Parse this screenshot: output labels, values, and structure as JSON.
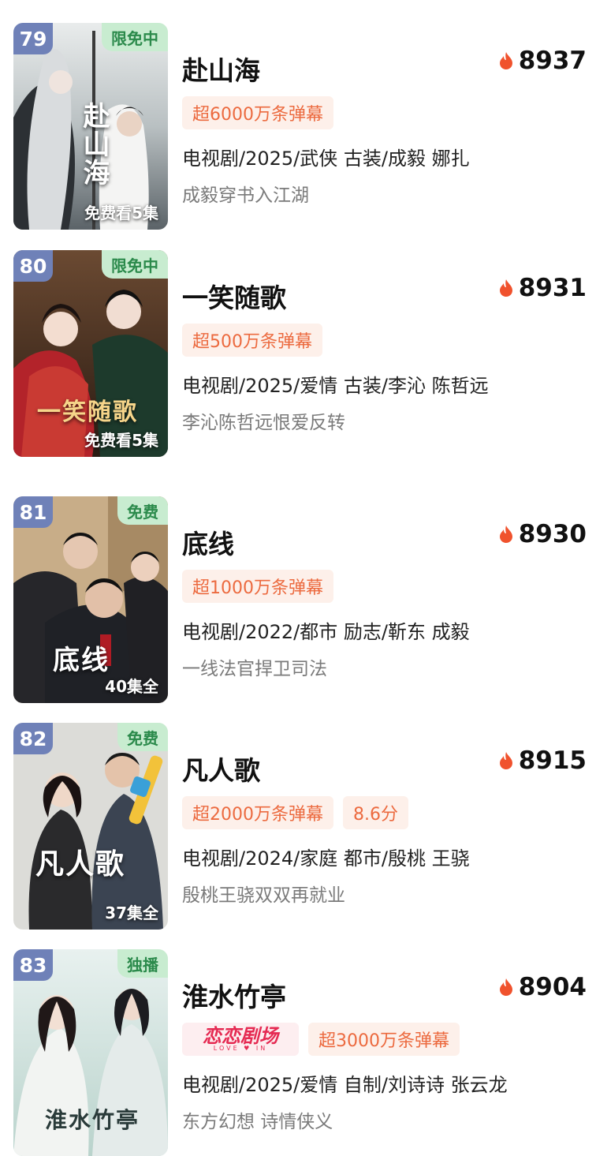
{
  "items": [
    {
      "rank": "79",
      "badge": "限免中",
      "badge_type": "limited-free",
      "episode_text": "免费看5集",
      "poster_art_text": "赴山海",
      "title": "赴山海",
      "heat": "8937",
      "tags": [
        "超6000万条弹幕"
      ],
      "meta": "电视剧/2025/武侠 古装/成毅 娜扎",
      "desc": "成毅穿书入江湖"
    },
    {
      "rank": "80",
      "badge": "限免中",
      "badge_type": "limited-free",
      "episode_text": "免费看5集",
      "poster_art_text": "一笑随歌",
      "title": "一笑随歌",
      "heat": "8931",
      "tags": [
        "超500万条弹幕"
      ],
      "meta": "电视剧/2025/爱情 古装/李沁 陈哲远",
      "desc": "李沁陈哲远恨爱反转"
    },
    {
      "rank": "81",
      "badge": "免费",
      "badge_type": "free",
      "episode_text": "40集全",
      "poster_art_text": "底线",
      "title": "底线",
      "heat": "8930",
      "tags": [
        "超1000万条弹幕"
      ],
      "meta": "电视剧/2022/都市 励志/靳东 成毅",
      "desc": "一线法官捍卫司法"
    },
    {
      "rank": "82",
      "badge": "免费",
      "badge_type": "free",
      "episode_text": "37集全",
      "poster_art_text": "凡人歌",
      "title": "凡人歌",
      "heat": "8915",
      "tags": [
        "超2000万条弹幕",
        "8.6分"
      ],
      "meta": "电视剧/2024/家庭 都市/殷桃 王骁",
      "desc": "殷桃王骁双双再就业"
    },
    {
      "rank": "83",
      "badge": "独播",
      "badge_type": "exclusive",
      "episode_text": "",
      "poster_art_text": "淮水竹亭",
      "title": "淮水竹亭",
      "heat": "8904",
      "brand_logo": "恋恋剧场",
      "brand_logo_sub": "LOVE ♥ IN",
      "tags": [
        "超3000万条弹幕"
      ],
      "meta": "电视剧/2025/爱情 自制/刘诗诗 张云龙",
      "desc": "东方幻想 诗情侠义"
    }
  ],
  "colors": {
    "rank_badge": "#6f81b8",
    "status_badge_bg": "#c8ecd0",
    "status_badge_text": "#2b8a4b",
    "tag_bg": "#fdf0ea",
    "tag_text": "#ec6a3f",
    "heat_icon": "#f0522d",
    "brand_logo": "#e52a52"
  },
  "icons": {
    "heat": "flame-icon"
  }
}
